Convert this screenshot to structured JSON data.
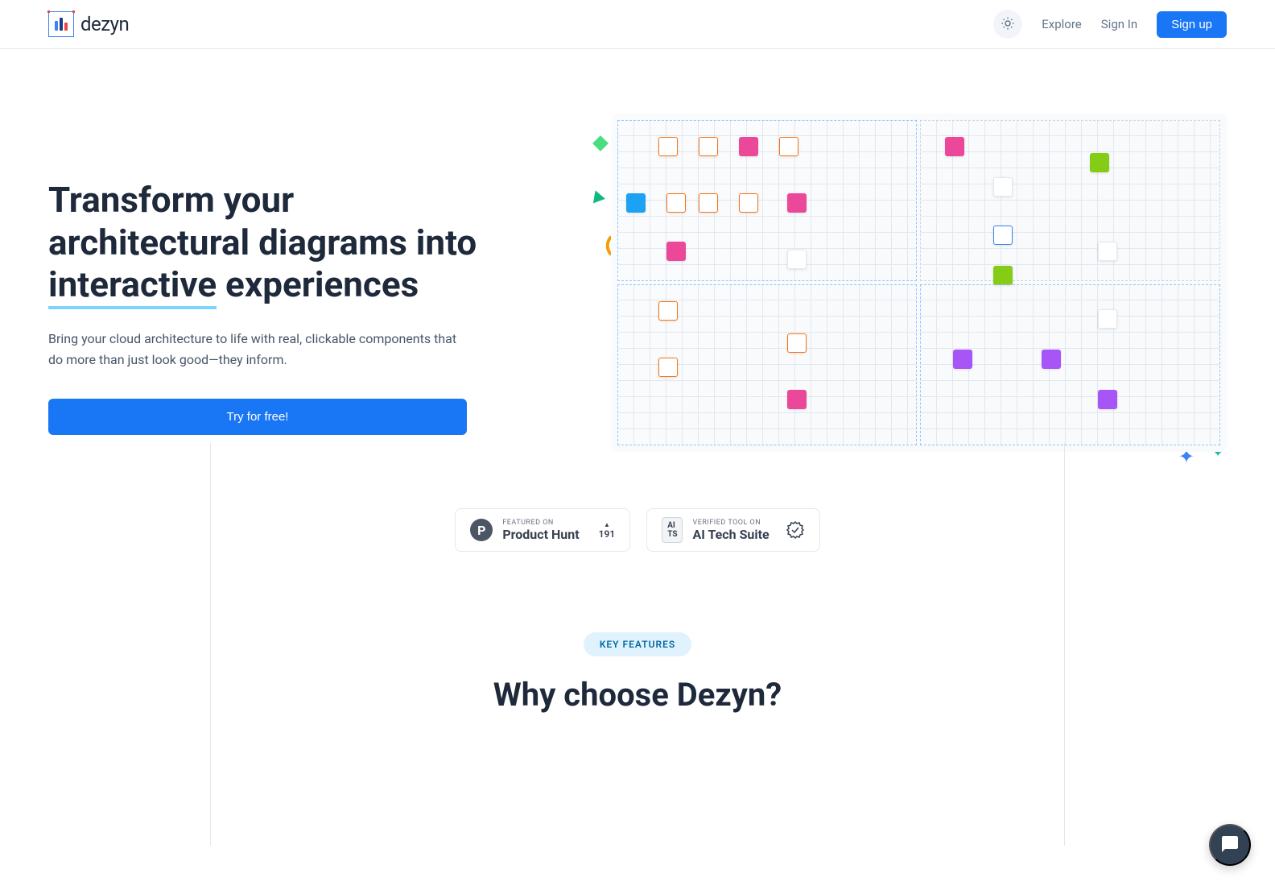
{
  "header": {
    "logo_text": "dezyn",
    "nav": {
      "explore": "Explore",
      "signin": "Sign In",
      "signup": "Sign up"
    }
  },
  "hero": {
    "title_line1": "Transform your",
    "title_line2": "architectural diagrams into",
    "title_highlight": "interactive",
    "title_after": " experiences",
    "subtitle": "Bring your cloud architecture to life with real, clickable components that do more than just look good—they inform.",
    "cta": "Try for free!"
  },
  "badges": {
    "ph": {
      "featured_on": "FEATURED ON",
      "name": "Product Hunt",
      "count": "191"
    },
    "aits": {
      "icon": "AI\nTS",
      "verified": "Verified Tool on",
      "name": "AI Tech Suite"
    }
  },
  "features": {
    "pill": "KEY FEATURES",
    "title": "Why choose Dezyn?"
  }
}
